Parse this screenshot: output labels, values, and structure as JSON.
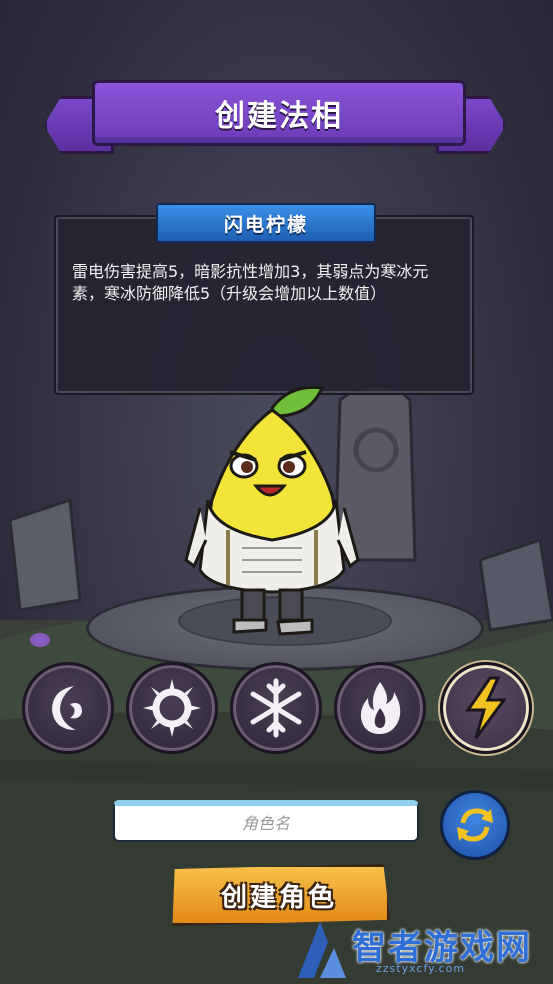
{
  "title": "创建法相",
  "description": {
    "tab_label": "闪电柠檬",
    "text": "雷电伤害提高5，暗影抗性增加3，其弱点为寒冰元素，寒冰防御降低5（升级会增加以上数值）"
  },
  "elements": [
    {
      "icon": "shadow-moon-icon",
      "selected": false
    },
    {
      "icon": "sun-ring-icon",
      "selected": false
    },
    {
      "icon": "snowflake-icon",
      "selected": false
    },
    {
      "icon": "fire-icon",
      "selected": false
    },
    {
      "icon": "lightning-icon",
      "selected": true
    }
  ],
  "name_input": {
    "value": "",
    "placeholder": "角色名"
  },
  "create_button": {
    "label": "创建角色"
  },
  "watermark": {
    "text": "智者游戏网",
    "url": "zzstyxcfy.com"
  },
  "colors": {
    "ribbon": "#7a48c8",
    "tab": "#2f7ad6",
    "create": "#f0a830",
    "accent_lightning": "#f2c320"
  }
}
